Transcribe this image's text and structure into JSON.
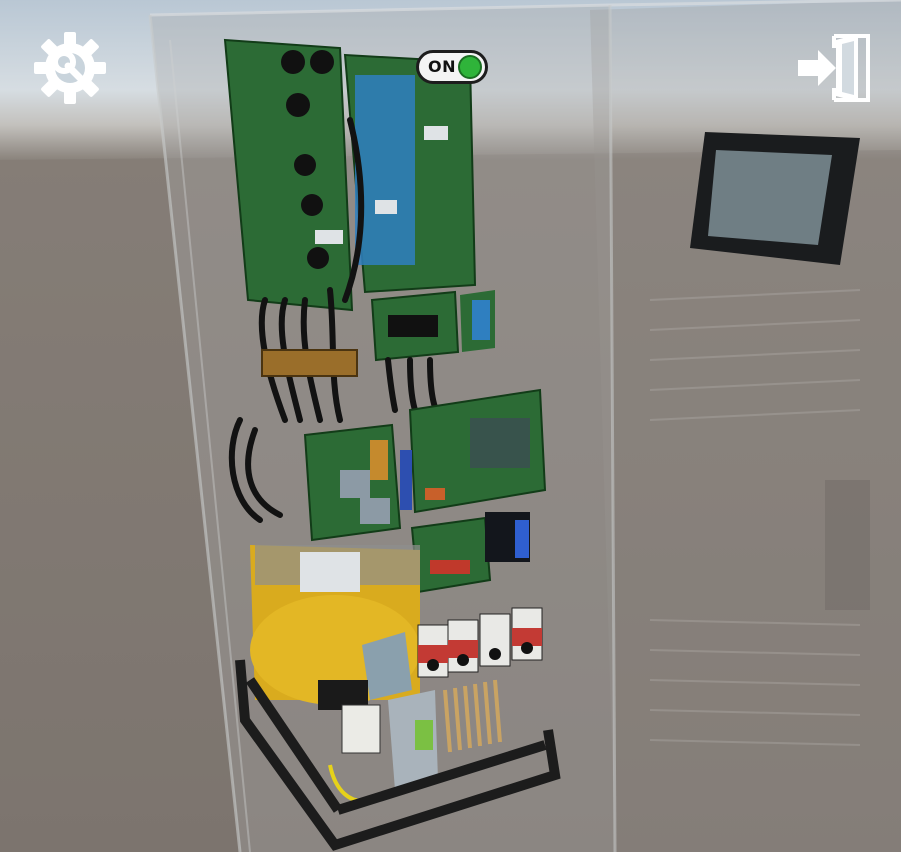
{
  "hud": {
    "settings_icon": "gear-wrench-icon",
    "exit_icon": "exit-door-icon",
    "power_toggle": {
      "label": "ON",
      "state": "on",
      "color": "#2fb43a"
    }
  },
  "scene": {
    "cabinet_icon": "electrical-cabinet-3d-model",
    "wall_display_icon": "wall-mounted-screen"
  }
}
